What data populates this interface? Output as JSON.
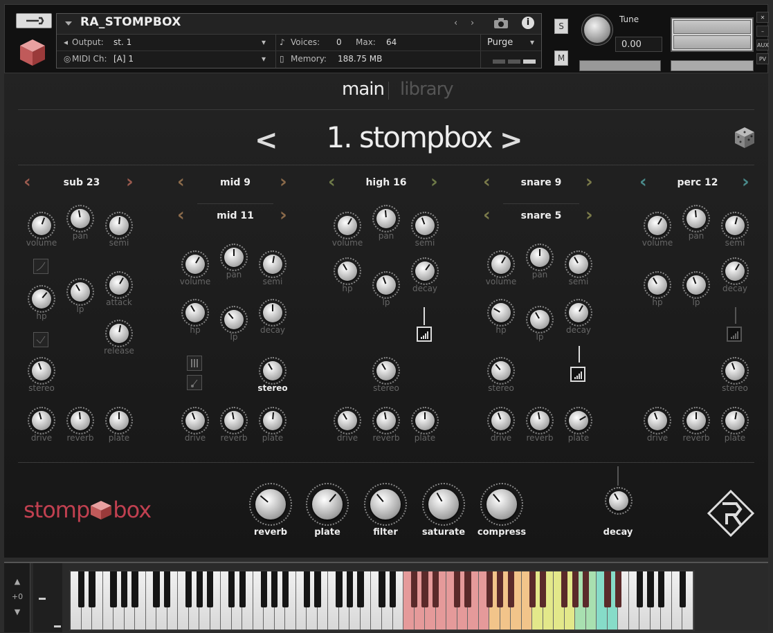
{
  "header": {
    "instrument_name": "RA_STOMPBOX",
    "output_label": "Output:",
    "output_value": "st. 1",
    "midi_label": "MIDI Ch:",
    "midi_value": "[A] 1",
    "voices_label": "Voices:",
    "voices_value": "0",
    "max_label": "Max:",
    "max_value": "64",
    "memory_label": "Memory:",
    "memory_value": "188.75 MB",
    "purge_label": "Purge",
    "solo_label": "S",
    "mute_label": "M",
    "tune_label": "Tune",
    "tune_value": "0.00",
    "aux_label": "AUX",
    "pv_label": "PV"
  },
  "tabs": {
    "main": "main",
    "library": "library"
  },
  "kit": {
    "name": "1. stompbox"
  },
  "channels": [
    {
      "name": "sub 23",
      "arrow_color": "#9a5a4e",
      "knobs": [
        "volume",
        "pan",
        "semi",
        "hp",
        "lp",
        "attack",
        "release",
        "stereo",
        "drive",
        "reverb",
        "plate"
      ]
    },
    {
      "name": "mid 9",
      "name2": "mid 11",
      "arrow_color": "#8a6a4a",
      "knobs": [
        "volume",
        "pan",
        "semi",
        "hp",
        "lp",
        "decay",
        "stereo",
        "drive",
        "reverb",
        "plate"
      ]
    },
    {
      "name": "high 16",
      "arrow_color": "#6e7a48",
      "knobs": [
        "volume",
        "pan",
        "semi",
        "hp",
        "lp",
        "decay",
        "stereo",
        "drive",
        "reverb",
        "plate"
      ]
    },
    {
      "name": "snare 9",
      "name2": "snare 5",
      "arrow_color": "#7a7a4a",
      "knobs": [
        "volume",
        "pan",
        "semi",
        "hp",
        "lp",
        "decay",
        "stereo",
        "drive",
        "reverb",
        "plate"
      ]
    },
    {
      "name": "perc 12",
      "arrow_color": "#4a8a8a",
      "knobs": [
        "volume",
        "pan",
        "semi",
        "hp",
        "lp",
        "decay",
        "stereo",
        "drive",
        "reverb",
        "plate"
      ]
    }
  ],
  "master": {
    "logo_text_left": "stomp",
    "logo_text_right": "box",
    "knobs": [
      "reverb",
      "plate",
      "filter",
      "saturate",
      "compress"
    ],
    "decay_label": "decay"
  },
  "keyboard": {
    "octave_label": "+0"
  },
  "colors": {
    "accent": "#c04050",
    "keys_red": "#e59a9a",
    "keys_orange": "#f2c48a",
    "keys_yellow": "#e3e88a",
    "keys_green": "#a8e0b0",
    "keys_teal": "#86dcc8"
  }
}
